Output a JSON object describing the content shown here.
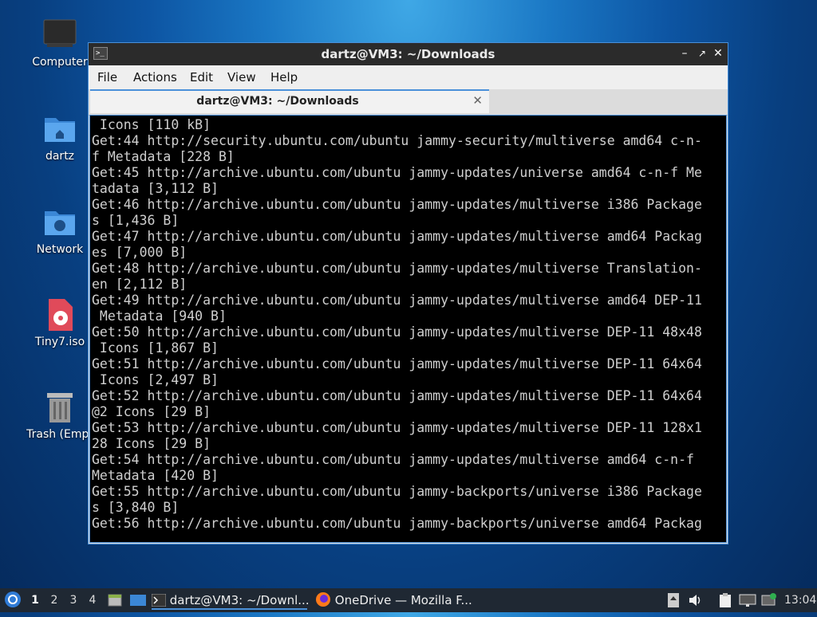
{
  "desktop": {
    "icons": [
      {
        "label": "Computer"
      },
      {
        "label": "dartz"
      },
      {
        "label": "Network"
      },
      {
        "label": "Tiny7.iso"
      },
      {
        "label": "Trash (Empt"
      }
    ]
  },
  "window": {
    "title": "dartz@VM3: ~/Downloads",
    "menu": [
      "File",
      "Actions",
      "Edit",
      "View",
      "Help"
    ],
    "tab_title": "dartz@VM3: ~/Downloads",
    "terminal_lines": [
      " Icons [110 kB]",
      "Get:44 http://security.ubuntu.com/ubuntu jammy-security/multiverse amd64 c-n-",
      "f Metadata [228 B]",
      "Get:45 http://archive.ubuntu.com/ubuntu jammy-updates/universe amd64 c-n-f Me",
      "tadata [3,112 B]",
      "Get:46 http://archive.ubuntu.com/ubuntu jammy-updates/multiverse i386 Package",
      "s [1,436 B]",
      "Get:47 http://archive.ubuntu.com/ubuntu jammy-updates/multiverse amd64 Packag",
      "es [7,000 B]",
      "Get:48 http://archive.ubuntu.com/ubuntu jammy-updates/multiverse Translation-",
      "en [2,112 B]",
      "Get:49 http://archive.ubuntu.com/ubuntu jammy-updates/multiverse amd64 DEP-11",
      " Metadata [940 B]",
      "Get:50 http://archive.ubuntu.com/ubuntu jammy-updates/multiverse DEP-11 48x48",
      " Icons [1,867 B]",
      "Get:51 http://archive.ubuntu.com/ubuntu jammy-updates/multiverse DEP-11 64x64",
      " Icons [2,497 B]",
      "Get:52 http://archive.ubuntu.com/ubuntu jammy-updates/multiverse DEP-11 64x64",
      "@2 Icons [29 B]",
      "Get:53 http://archive.ubuntu.com/ubuntu jammy-updates/multiverse DEP-11 128x1",
      "28 Icons [29 B]",
      "Get:54 http://archive.ubuntu.com/ubuntu jammy-updates/multiverse amd64 c-n-f",
      "Metadata [420 B]",
      "Get:55 http://archive.ubuntu.com/ubuntu jammy-backports/universe i386 Package",
      "s [3,840 B]",
      "Get:56 http://archive.ubuntu.com/ubuntu jammy-backports/universe amd64 Packag"
    ]
  },
  "taskbar": {
    "workspaces": [
      "1",
      "2",
      "3",
      "4"
    ],
    "tasks": [
      {
        "label": "dartz@VM3: ~/Downl..."
      },
      {
        "label": "OneDrive — Mozilla F..."
      }
    ],
    "clock": "13:04"
  }
}
